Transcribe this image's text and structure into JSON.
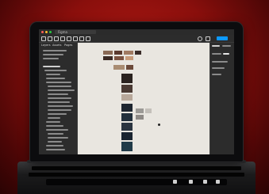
{
  "scene": {
    "background_color": "#a51812",
    "device": "laptop",
    "app": "design editor"
  },
  "app_window": {
    "tab_label": "Figma",
    "file_label": "",
    "share_color": "#0d99ff"
  },
  "sidebar": {
    "tabs": [
      "Layers",
      "Assets",
      "Pages"
    ],
    "layer_count": 26
  },
  "right_panel": {
    "tab": "Design"
  }
}
